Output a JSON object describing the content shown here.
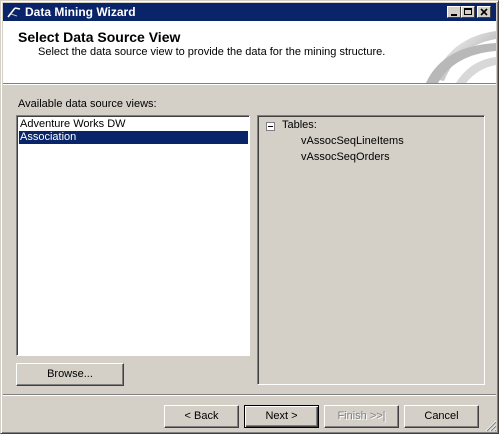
{
  "window": {
    "title": "Data Mining Wizard",
    "title_bar_color": "#0a246a"
  },
  "header": {
    "title": "Select Data Source View",
    "subtitle": "Select the data source view to provide the data for the mining structure."
  },
  "data_source_views": {
    "label": "Available data source views:",
    "items": [
      {
        "label": "Adventure Works DW",
        "selected": false
      },
      {
        "label": "Association",
        "selected": true
      }
    ],
    "browse_label": "Browse..."
  },
  "tables_tree": {
    "root_label": "Tables:",
    "expanded": true,
    "children": [
      "vAssocSeqLineItems",
      "vAssocSeqOrders"
    ]
  },
  "footer": {
    "back_label": "< Back",
    "next_label": "Next >",
    "finish_label": "Finish >>|",
    "cancel_label": "Cancel"
  },
  "icons": {
    "app": "wizard-icon",
    "minimize": "minimize-icon",
    "maximize": "maximize-icon",
    "close": "close-icon",
    "tree_toggle": "collapse-icon",
    "size_grip": "size-grip-icon"
  }
}
